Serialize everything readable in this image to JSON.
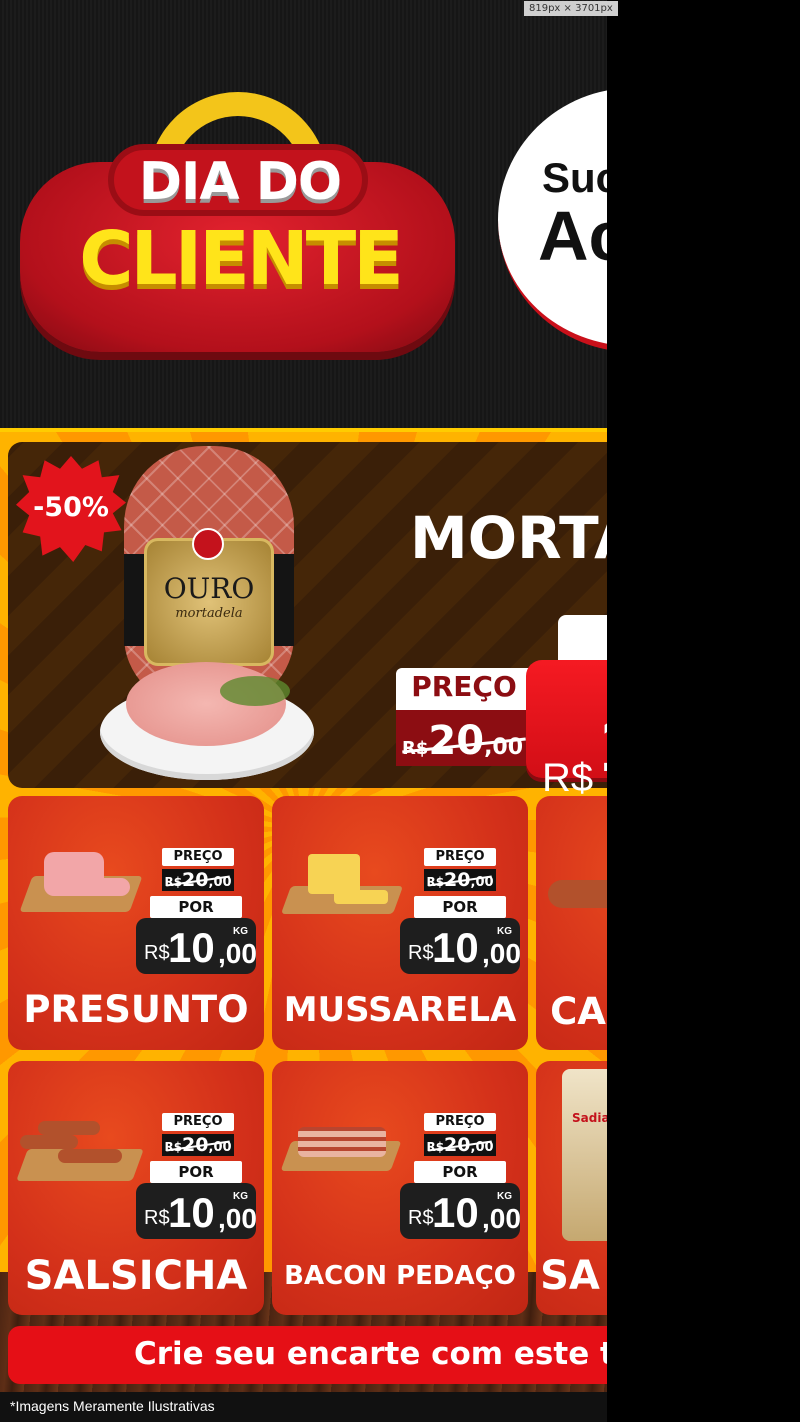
{
  "browser": {
    "dimension_badge": "819px × 3701px"
  },
  "header": {
    "logo_line1": "DIA DO",
    "logo_line2": "CLIENTE",
    "circle_line1": "Suc",
    "circle_line2": "Ac"
  },
  "feature": {
    "discount": "-50%",
    "product_name": "MORTA",
    "package_brand": "OURO",
    "package_sub": "mortadela",
    "price_label": "PREÇO",
    "old_currency": "R$",
    "old_int": "20",
    "old_dec": ",00",
    "new_currency": "R$",
    "new_int": "1"
  },
  "cards": [
    {
      "name": "PRESUNTO",
      "preco_label": "PREÇO",
      "old_currency": "R$",
      "old_int": "20",
      "old_dec": ",00",
      "por_label": "POR",
      "new_currency": "R$",
      "new_int": "10",
      "new_dec": ",00",
      "unit": "KG"
    },
    {
      "name": "MUSSARELA",
      "preco_label": "PREÇO",
      "old_currency": "R$",
      "old_int": "20",
      "old_dec": ",00",
      "por_label": "POR",
      "new_currency": "R$",
      "new_int": "10",
      "new_dec": ",00",
      "unit": "KG"
    },
    {
      "name": "CA"
    },
    {
      "name": "SALSICHA",
      "preco_label": "PREÇO",
      "old_currency": "R$",
      "old_int": "20",
      "old_dec": ",00",
      "por_label": "POR",
      "new_currency": "R$",
      "new_int": "10",
      "new_dec": ",00",
      "unit": "KG"
    },
    {
      "name": "BACON PEDAÇO",
      "preco_label": "PREÇO",
      "old_currency": "R$",
      "old_int": "20",
      "old_dec": ",00",
      "por_label": "POR",
      "new_currency": "R$",
      "new_int": "10",
      "new_dec": ",00",
      "unit": "KG"
    },
    {
      "name": "SA",
      "package_brand": "Sadia"
    }
  ],
  "cta": {
    "text": "Crie seu encarte com este te"
  },
  "disclaimer": "*Imagens Meramente Ilustrativas",
  "colors": {
    "accent_red": "#e50f16",
    "gold": "#ffb300",
    "dark_brown": "#3a1f08",
    "yellow_logo": "#ffe41a"
  }
}
